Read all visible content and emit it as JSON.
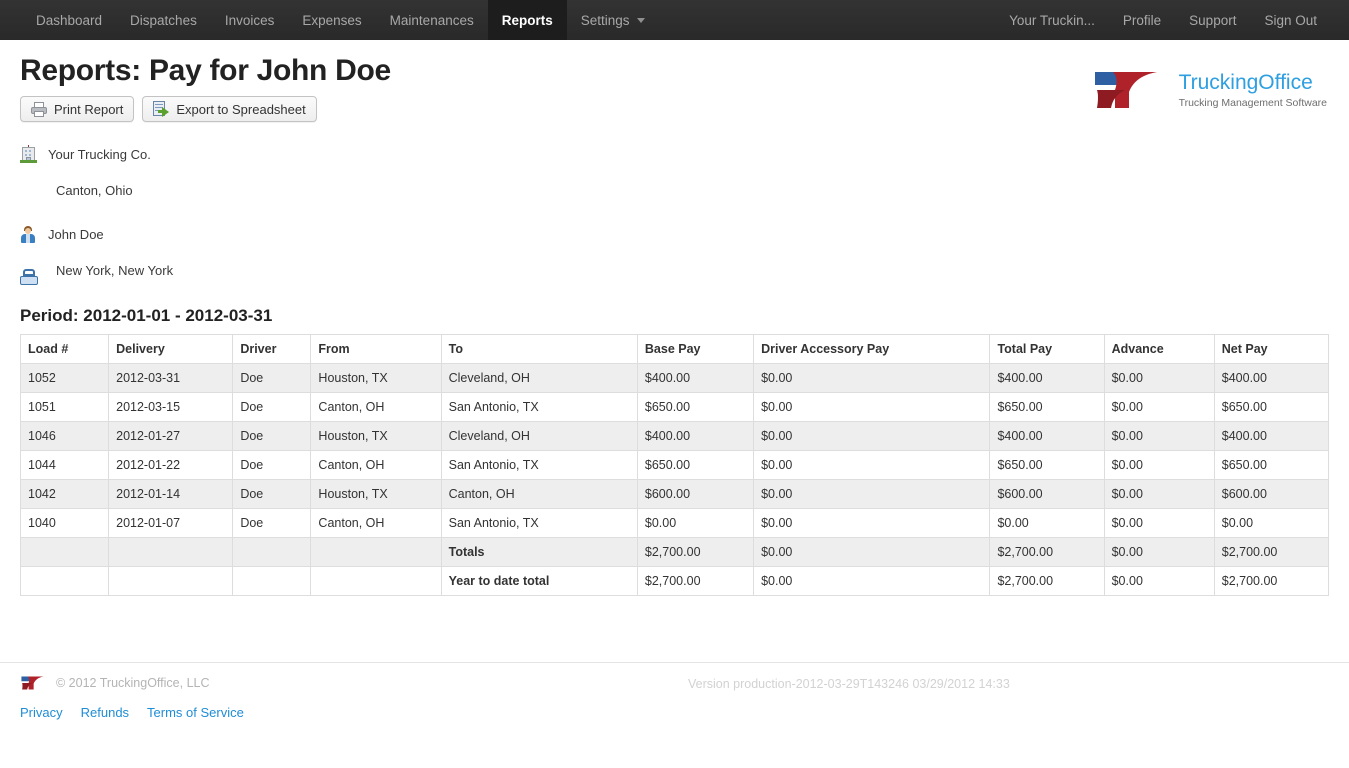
{
  "nav": {
    "left_items": [
      {
        "label": "Dashboard",
        "active": false,
        "name": "nav-dashboard"
      },
      {
        "label": "Dispatches",
        "active": false,
        "name": "nav-dispatches"
      },
      {
        "label": "Invoices",
        "active": false,
        "name": "nav-invoices"
      },
      {
        "label": "Expenses",
        "active": false,
        "name": "nav-expenses"
      },
      {
        "label": "Maintenances",
        "active": false,
        "name": "nav-maintenances"
      },
      {
        "label": "Reports",
        "active": true,
        "name": "nav-reports"
      },
      {
        "label": "Settings",
        "active": false,
        "caret": true,
        "name": "nav-settings"
      }
    ],
    "right_items": [
      {
        "label": "Your Truckin...",
        "name": "nav-account"
      },
      {
        "label": "Profile",
        "name": "nav-profile"
      },
      {
        "label": "Support",
        "name": "nav-support"
      },
      {
        "label": "Sign Out",
        "name": "nav-signout"
      }
    ]
  },
  "header": {
    "title": "Reports: Pay for John Doe",
    "print_label": "Print Report",
    "export_label": "Export to Spreadsheet"
  },
  "logo": {
    "title": "TruckingOffice",
    "subtitle": "Trucking Management Software",
    "blue": "#2e5fa3",
    "red": "#b0222a",
    "text_blue": "#2e9fe0"
  },
  "info": {
    "company_name": "Your Trucking Co.",
    "company_city": "Canton, Ohio",
    "driver_name": "John Doe",
    "driver_city": "New York, New York"
  },
  "report": {
    "period": "Period: 2012-01-01 - 2012-03-31",
    "columns": [
      "Load #",
      "Delivery",
      "Driver",
      "From",
      "To",
      "Base Pay",
      "Driver Accessory Pay",
      "Total Pay",
      "Advance",
      "Net Pay"
    ],
    "rows": [
      [
        "1052",
        "2012-03-31",
        "Doe",
        "Houston, TX",
        "Cleveland, OH",
        "$400.00",
        "$0.00",
        "$400.00",
        "$0.00",
        "$400.00"
      ],
      [
        "1051",
        "2012-03-15",
        "Doe",
        "Canton, OH",
        "San Antonio, TX",
        "$650.00",
        "$0.00",
        "$650.00",
        "$0.00",
        "$650.00"
      ],
      [
        "1046",
        "2012-01-27",
        "Doe",
        "Houston, TX",
        "Cleveland, OH",
        "$400.00",
        "$0.00",
        "$400.00",
        "$0.00",
        "$400.00"
      ],
      [
        "1044",
        "2012-01-22",
        "Doe",
        "Canton, OH",
        "San Antonio, TX",
        "$650.00",
        "$0.00",
        "$650.00",
        "$0.00",
        "$650.00"
      ],
      [
        "1042",
        "2012-01-14",
        "Doe",
        "Houston, TX",
        "Canton, OH",
        "$600.00",
        "$0.00",
        "$600.00",
        "$0.00",
        "$600.00"
      ],
      [
        "1040",
        "2012-01-07",
        "Doe",
        "Canton, OH",
        "San Antonio, TX",
        "$0.00",
        "$0.00",
        "$0.00",
        "$0.00",
        "$0.00"
      ],
      [
        "",
        "",
        "",
        "",
        "Totals",
        "$2,700.00",
        "$0.00",
        "$2,700.00",
        "$0.00",
        "$2,700.00"
      ],
      [
        "",
        "",
        "",
        "",
        "Year to date total",
        "$2,700.00",
        "$0.00",
        "$2,700.00",
        "$0.00",
        "$2,700.00"
      ]
    ]
  },
  "footer": {
    "copyright": "© 2012 TruckingOffice, LLC",
    "version": "Version production-2012-03-29T143246 03/29/2012 14:33",
    "links": [
      {
        "label": "Privacy",
        "name": "footer-link-privacy"
      },
      {
        "label": "Refunds",
        "name": "footer-link-refunds"
      },
      {
        "label": "Terms of Service",
        "name": "footer-link-terms"
      }
    ]
  }
}
